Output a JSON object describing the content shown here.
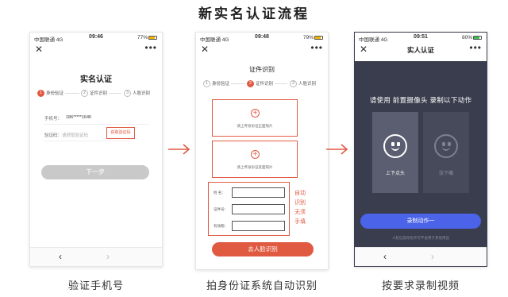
{
  "title": "新实名认证流程",
  "captions": [
    "验证手机号",
    "拍身份证系统自动识别",
    "按要求录制视频"
  ],
  "colors": {
    "accent": "#e05a42",
    "primary_blue": "#4a63e8",
    "dark_bg": "#3a3d4d"
  },
  "phone1": {
    "status": {
      "carrier": "中国联通 4G",
      "time": "09:46",
      "battery": "77%"
    },
    "nav": {
      "close": "✕",
      "more": "•••"
    },
    "page_title": "实名认证",
    "steps": [
      {
        "num": "1",
        "label": "身份验证"
      },
      {
        "num": "2",
        "label": "证件识别"
      },
      {
        "num": "3",
        "label": "人脸识别"
      }
    ],
    "phone_label": "手机号：",
    "phone_value": "186*****1645",
    "code_label": "验证码：",
    "code_placeholder": "请获取验证码",
    "sms_button": "获取验证码",
    "next_button": "下一步",
    "back": "‹",
    "forward": "›"
  },
  "phone2": {
    "status": {
      "carrier": "中国联通 4G",
      "time": "09:48",
      "battery": "79%"
    },
    "nav": {
      "close": "✕",
      "more": "•••"
    },
    "page_title": "证件识别",
    "steps": [
      {
        "num": "1",
        "label": "身份验证"
      },
      {
        "num": "2",
        "label": "证件识别"
      },
      {
        "num": "3",
        "label": "人脸识别"
      }
    ],
    "upload_front": "请上传身份证正面照片",
    "upload_back": "请上传身份证反面照片",
    "fields": [
      "姓    名：",
      "证件号：",
      "有效期："
    ],
    "auto_note": [
      "自动",
      "识别",
      "无须",
      "手填"
    ],
    "face_button": "去人脸识别",
    "back": "‹",
    "forward": "›"
  },
  "phone3": {
    "status": {
      "carrier": "中国联通 4G",
      "time": "09:51",
      "battery": "80%"
    },
    "nav": {
      "close": "✕",
      "more": "•••"
    },
    "page_title": "实人认证",
    "instruction": "请使用 前置摄像头 录制以下动作",
    "action_on": "上下点头",
    "action_off": "张下嘴",
    "record_button": "录制动作一",
    "privacy": "人脸信息你您许可不会用于其他用途",
    "back": "‹",
    "forward": "›"
  }
}
